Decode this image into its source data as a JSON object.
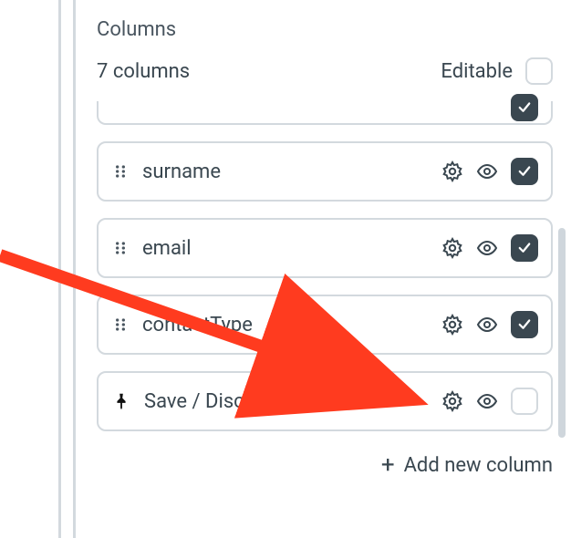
{
  "section": {
    "title": "Columns"
  },
  "summary": {
    "count_label": "7 columns",
    "editable_label": "Editable",
    "editable_checked": false
  },
  "columns": [
    {
      "key": "surname",
      "label": "surname",
      "pinned": false,
      "checked": true
    },
    {
      "key": "email",
      "label": "email",
      "pinned": false,
      "checked": true
    },
    {
      "key": "contactType",
      "label": "contactType",
      "pinned": false,
      "checked": true
    },
    {
      "key": "saveDiscard",
      "label": "Save / Discard",
      "pinned": true,
      "checked": false
    }
  ],
  "footer": {
    "add_label": "Add new column"
  },
  "icons": {
    "gear": "gear-icon",
    "eye": "eye-icon",
    "drag": "drag-handle-icon",
    "pin": "pin-icon",
    "plus": "plus-icon",
    "check": "check-icon"
  }
}
